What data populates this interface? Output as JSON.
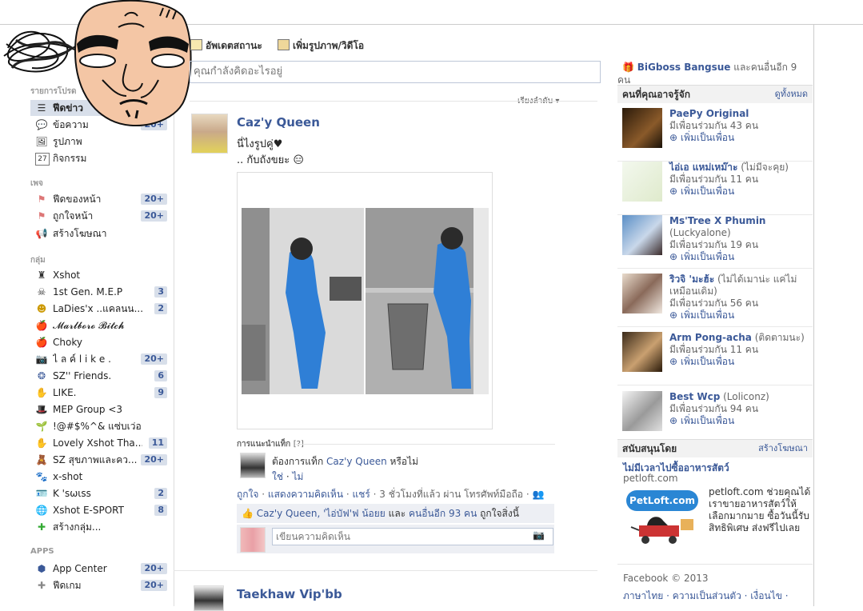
{
  "composer": {
    "tab_status": "อัพเดตสถานะ",
    "tab_photo": "เพิ่มรูปภาพ/วิดีโอ",
    "placeholder": "คุณกำลังคิดอะไรอยู่",
    "sort_label": "เรียงลำดับ"
  },
  "left": {
    "section_favorites": "รายการโปรด",
    "favorites": [
      {
        "label": "ฟีดข่าว",
        "count": ""
      },
      {
        "label": "ข้อความ",
        "count": "20+"
      },
      {
        "label": "รูปภาพ",
        "count": ""
      },
      {
        "label": "กิจกรรม",
        "count": ""
      }
    ],
    "section_pages": "เพจ",
    "pages": [
      {
        "label": "ฟีดของหน้า",
        "count": "20+"
      },
      {
        "label": "ถูกใจหน้า",
        "count": "20+"
      },
      {
        "label": "สร้างโฆษณา",
        "count": ""
      }
    ],
    "section_groups": "กลุ่ม",
    "groups": [
      {
        "label": "Xshot",
        "count": ""
      },
      {
        "label": "1st Gen. M.E.P",
        "count": "3"
      },
      {
        "label": "LaDies'x ..แคลนน...",
        "count": "2"
      },
      {
        "label": "𝓜𝓪𝓻𝓵𝓫𝓸𝓻𝓸 𝓑𝓲𝓽𝓬𝓱",
        "count": ""
      },
      {
        "label": "Choky",
        "count": ""
      },
      {
        "label": "ไ ล ค์ l i k e .",
        "count": "20+"
      },
      {
        "label": "SZ'' Friends.",
        "count": "6"
      },
      {
        "label": "LIKE.",
        "count": "9"
      },
      {
        "label": "MEP Group <3",
        "count": ""
      },
      {
        "label": "!@#$%^& แซ่บเว่อ '",
        "count": ""
      },
      {
        "label": "Lovely Xshot Tha...",
        "count": "11"
      },
      {
        "label": "SZ สุขภาพและคว...",
        "count": "20+"
      },
      {
        "label": "x-shot",
        "count": ""
      },
      {
        "label": "K 'sωιss",
        "count": "2"
      },
      {
        "label": "Xshot E-SPORT",
        "count": "8"
      },
      {
        "label": "สร้างกลุ่ม...",
        "count": ""
      }
    ],
    "section_apps": "APPS",
    "apps": [
      {
        "label": "App Center",
        "count": "20+"
      },
      {
        "label": "ฟีดเกม",
        "count": "20+"
      }
    ]
  },
  "post": {
    "author": "Caz'y Queen",
    "line1": "นี่ไงรูปคู่♥",
    "line2": ".. กับถังขยะ 😑",
    "tag_title": "การแนะนำแท็ก",
    "tag_help": "[?]",
    "tag_question_prefix": "ต้องการแท็ก",
    "tag_name": "Caz'y Queen",
    "tag_question_suffix": "หรือไม่",
    "yes": "ใช่",
    "no": "ไม่",
    "action_like": "ถูกใจ",
    "action_comment": "แสดงความคิดเห็น",
    "action_share": "แชร์",
    "action_time": "3 ชั่วโมงที่แล้ว ผ่าน โทรศัพท์มือถือ",
    "likes_names": "Caz'y Queen, 'ไอ่บัฟ'ฟ น้อยย",
    "likes_and": "และ",
    "likes_others": "คนอื่นอีก 93 คน",
    "likes_suffix": "ถูกใจสิ่งนี้",
    "comment_placeholder": "เขียนความคิดเห็น"
  },
  "post2": {
    "author": "Taekhaw Vip'bb"
  },
  "right": {
    "birthday_name": "BiGboss Bangsue",
    "birthday_suffix": "และคนอื่นอีก 9 คน",
    "pymk_title": "คนที่คุณอาจรู้จัก",
    "pymk_all": "ดูทั้งหมด",
    "add_friend": "เพิ่มเป็นเพื่อน",
    "people": [
      {
        "name": "PaePy Original",
        "extra": "",
        "mutual": "มีเพื่อนร่วมกัน 43 คน"
      },
      {
        "name": "ไอ่เอ แหม่เหม๊าะ",
        "extra": "(ไม่มีจะคุย)",
        "mutual": "มีเพื่อนร่วมกัน 11 คน"
      },
      {
        "name": "Ms'Tree X Phumin",
        "extra": "(Luckyalone)",
        "mutual": "มีเพื่อนร่วมกัน 19 คน"
      },
      {
        "name": "ริวจิ 'มะฮ้ะ",
        "extra": "(ไม่ได้เมาน่ะ แค่ไม่เหมือนเดิม)",
        "mutual": "มีเพื่อนร่วมกัน 56 คน"
      },
      {
        "name": "Arm Pong-acha",
        "extra": "(ติดตามนะ)",
        "mutual": "มีเพื่อนร่วมกัน 11 คน"
      },
      {
        "name": "Best Wcp",
        "extra": "(Loliconz)",
        "mutual": "มีเพื่อนร่วมกัน 94 คน"
      }
    ],
    "sponsored_title": "สนับสนุนโดย",
    "create_ad": "สร้างโฆษณา",
    "ad_title": "ไม่มีเวลาไปซื้ออาหารสัตว์",
    "ad_domain": "petloft.com",
    "ad_logo_text": "PetLoft.com",
    "ad_body": "petloft.com ช่วยคุณได้ เราขายอาหารสัตว์ให้เลือกมากมาย ซื้อวันนี้รับสิทธิพิเศษ ส่งฟรีไปเลย",
    "footer_copy": "Facebook © 2013",
    "footer_links": "ภาษาไทย · ความเป็นส่วนตัว · เงื่อนไข ·"
  },
  "colors": {
    "brand": "#3b5998",
    "count_bg": "#d8dfea",
    "panel": "#edeff4"
  }
}
